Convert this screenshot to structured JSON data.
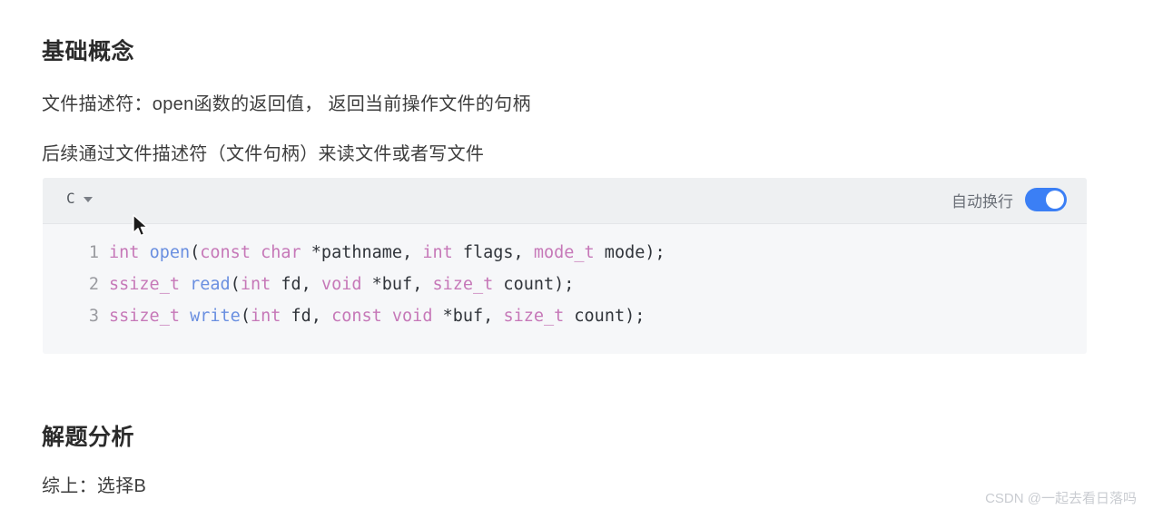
{
  "sections": {
    "basics_title": "基础概念",
    "paragraph_1": "文件描述符：open函数的返回值， 返回当前操作文件的句柄",
    "paragraph_2": "后续通过文件描述符（文件句柄）来读文件或者写文件",
    "analysis_title": "解题分析",
    "paragraph_3": "综上：选择B"
  },
  "code_block": {
    "language": "C",
    "wrap_label": "自动换行",
    "wrap_enabled": true,
    "accent_color": "#3b7ff5",
    "header_bg": "#eef0f2",
    "body_bg": "#f6f7f9",
    "lines": [
      {
        "number": "1",
        "tokens": [
          {
            "text": "int",
            "type": "type"
          },
          {
            "text": " ",
            "type": "plain"
          },
          {
            "text": "open",
            "type": "fn"
          },
          {
            "text": "(",
            "type": "plain"
          },
          {
            "text": "const char",
            "type": "type"
          },
          {
            "text": " *pathname, ",
            "type": "plain"
          },
          {
            "text": "int",
            "type": "type"
          },
          {
            "text": " flags, ",
            "type": "plain"
          },
          {
            "text": "mode_t",
            "type": "type"
          },
          {
            "text": " mode);",
            "type": "plain"
          }
        ]
      },
      {
        "number": "2",
        "tokens": [
          {
            "text": "ssize_t",
            "type": "type"
          },
          {
            "text": " ",
            "type": "plain"
          },
          {
            "text": "read",
            "type": "fn"
          },
          {
            "text": "(",
            "type": "plain"
          },
          {
            "text": "int",
            "type": "type"
          },
          {
            "text": " fd, ",
            "type": "plain"
          },
          {
            "text": "void",
            "type": "type"
          },
          {
            "text": " *buf, ",
            "type": "plain"
          },
          {
            "text": "size_t",
            "type": "type"
          },
          {
            "text": " count);",
            "type": "plain"
          }
        ]
      },
      {
        "number": "3",
        "tokens": [
          {
            "text": "ssize_t",
            "type": "type"
          },
          {
            "text": " ",
            "type": "plain"
          },
          {
            "text": "write",
            "type": "fn"
          },
          {
            "text": "(",
            "type": "plain"
          },
          {
            "text": "int",
            "type": "type"
          },
          {
            "text": " fd, ",
            "type": "plain"
          },
          {
            "text": "const void",
            "type": "type"
          },
          {
            "text": " *buf, ",
            "type": "plain"
          },
          {
            "text": "size_t",
            "type": "type"
          },
          {
            "text": " count);",
            "type": "plain"
          }
        ]
      }
    ]
  },
  "watermark": {
    "text": "CSDN @一起去看日落吗"
  }
}
